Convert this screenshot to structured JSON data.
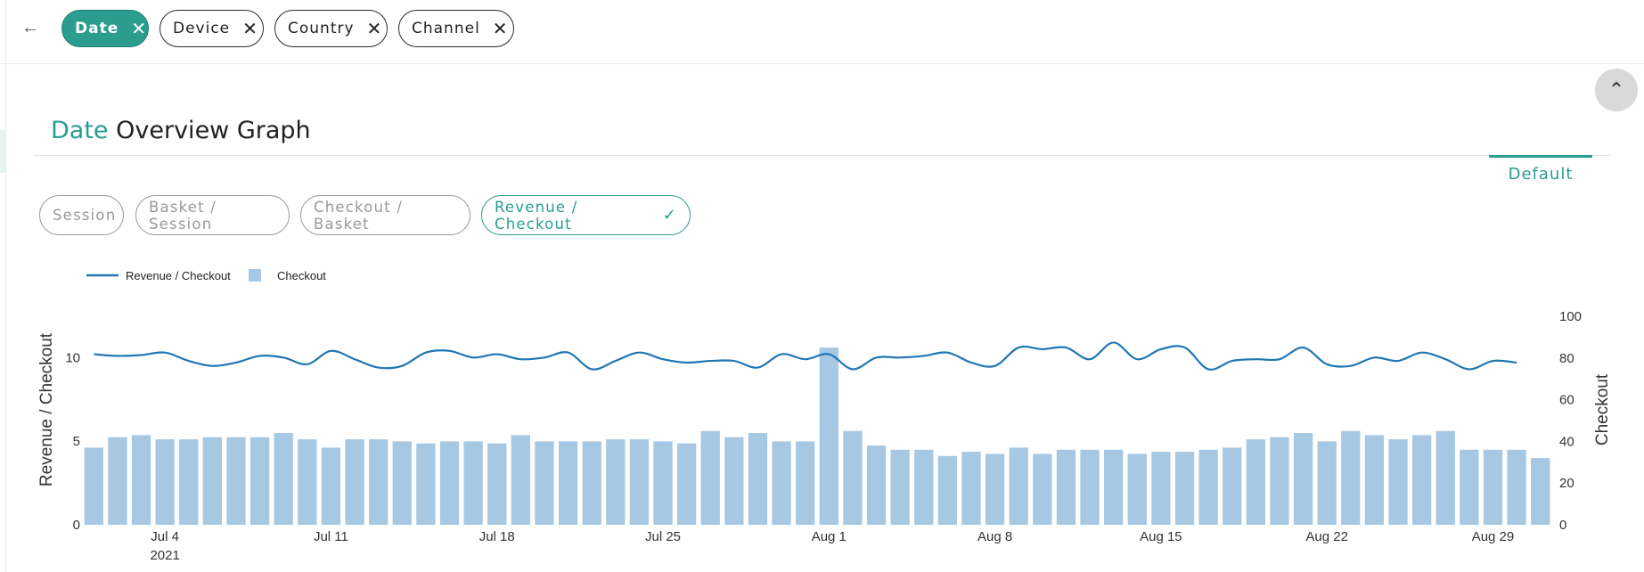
{
  "toolbar": {
    "back_icon": "arrow-left-icon",
    "chips": [
      {
        "label": "Date",
        "active": true
      },
      {
        "label": "Device",
        "active": false
      },
      {
        "label": "Country",
        "active": false
      },
      {
        "label": "Channel",
        "active": false
      }
    ]
  },
  "section": {
    "title_accent": "Date",
    "title_rest": "Overview Graph",
    "view_tab": "Default"
  },
  "metrics": [
    {
      "label": "Session",
      "active": false
    },
    {
      "label": "Basket / Session",
      "active": false
    },
    {
      "label": "Checkout / Basket",
      "active": false
    },
    {
      "label": "Revenue / Checkout",
      "active": true
    }
  ],
  "colors": {
    "accent": "#2a9d8f",
    "line": "#1f77b4",
    "bar": "#a6c8e2"
  },
  "chart_data": {
    "type": "bar+line",
    "x_dates": [
      "2021-07-01",
      "2021-07-02",
      "2021-07-03",
      "2021-07-04",
      "2021-07-05",
      "2021-07-06",
      "2021-07-07",
      "2021-07-08",
      "2021-07-09",
      "2021-07-10",
      "2021-07-11",
      "2021-07-12",
      "2021-07-13",
      "2021-07-14",
      "2021-07-15",
      "2021-07-16",
      "2021-07-17",
      "2021-07-18",
      "2021-07-19",
      "2021-07-20",
      "2021-07-21",
      "2021-07-22",
      "2021-07-23",
      "2021-07-24",
      "2021-07-25",
      "2021-07-26",
      "2021-07-27",
      "2021-07-28",
      "2021-07-29",
      "2021-07-30",
      "2021-07-31",
      "2021-08-01",
      "2021-08-02",
      "2021-08-03",
      "2021-08-04",
      "2021-08-05",
      "2021-08-06",
      "2021-08-07",
      "2021-08-08",
      "2021-08-09",
      "2021-08-10",
      "2021-08-11",
      "2021-08-12",
      "2021-08-13",
      "2021-08-14",
      "2021-08-15",
      "2021-08-16",
      "2021-08-17",
      "2021-08-18",
      "2021-08-19",
      "2021-08-20",
      "2021-08-21",
      "2021-08-22",
      "2021-08-23",
      "2021-08-24",
      "2021-08-25",
      "2021-08-26",
      "2021-08-27",
      "2021-08-28",
      "2021-08-29",
      "2021-08-30",
      "2021-08-31"
    ],
    "series": [
      {
        "name": "Revenue / Checkout",
        "type": "line",
        "axis": "left",
        "values": [
          10.2,
          10.1,
          10.15,
          10.3,
          9.8,
          9.5,
          9.7,
          10.1,
          10.0,
          9.6,
          10.4,
          9.9,
          9.4,
          9.5,
          10.3,
          10.4,
          10.0,
          10.2,
          9.9,
          10.0,
          10.3,
          9.3,
          9.8,
          10.3,
          9.9,
          9.7,
          9.8,
          9.8,
          9.4,
          10.2,
          9.9,
          10.2,
          9.3,
          10.0,
          10.0,
          10.1,
          10.3,
          9.7,
          9.5,
          10.6,
          10.5,
          10.6,
          9.9,
          10.9,
          9.9,
          10.5,
          10.6,
          9.3,
          9.8,
          9.9,
          9.9,
          10.6,
          9.6,
          9.5,
          10.0,
          9.8,
          10.3,
          9.9,
          9.3,
          9.8,
          9.7
        ]
      },
      {
        "name": "Checkout",
        "type": "bar",
        "axis": "right",
        "values": [
          37,
          42,
          43,
          41,
          41,
          42,
          42,
          42,
          44,
          41,
          37,
          41,
          41,
          40,
          39,
          40,
          40,
          39,
          43,
          40,
          40,
          40,
          41,
          41,
          40,
          39,
          45,
          42,
          44,
          40,
          40,
          85,
          45,
          38,
          36,
          36,
          33,
          35,
          34,
          37,
          34,
          36,
          36,
          36,
          34,
          35,
          35,
          36,
          37,
          41,
          42,
          44,
          40,
          45,
          43,
          41,
          43,
          45,
          36,
          36,
          36,
          32
        ]
      }
    ],
    "y_left": {
      "label": "Revenue / Checkout",
      "ticks": [
        "0",
        "5",
        "10"
      ],
      "range": [
        0,
        13
      ]
    },
    "y_right": {
      "label": "Checkout",
      "ticks": [
        "0",
        "20",
        "40",
        "60",
        "80",
        "100"
      ],
      "range": [
        0,
        100
      ]
    },
    "x_ticks": [
      {
        "date": "2021-07-04",
        "label": "Jul 4",
        "sub": "2021"
      },
      {
        "date": "2021-07-11",
        "label": "Jul 11"
      },
      {
        "date": "2021-07-18",
        "label": "Jul 18"
      },
      {
        "date": "2021-07-25",
        "label": "Jul 25"
      },
      {
        "date": "2021-08-01",
        "label": "Aug 1"
      },
      {
        "date": "2021-08-08",
        "label": "Aug 8"
      },
      {
        "date": "2021-08-15",
        "label": "Aug 15"
      },
      {
        "date": "2021-08-22",
        "label": "Aug 22"
      },
      {
        "date": "2021-08-29",
        "label": "Aug 29"
      }
    ],
    "legend_position": "top-left"
  }
}
